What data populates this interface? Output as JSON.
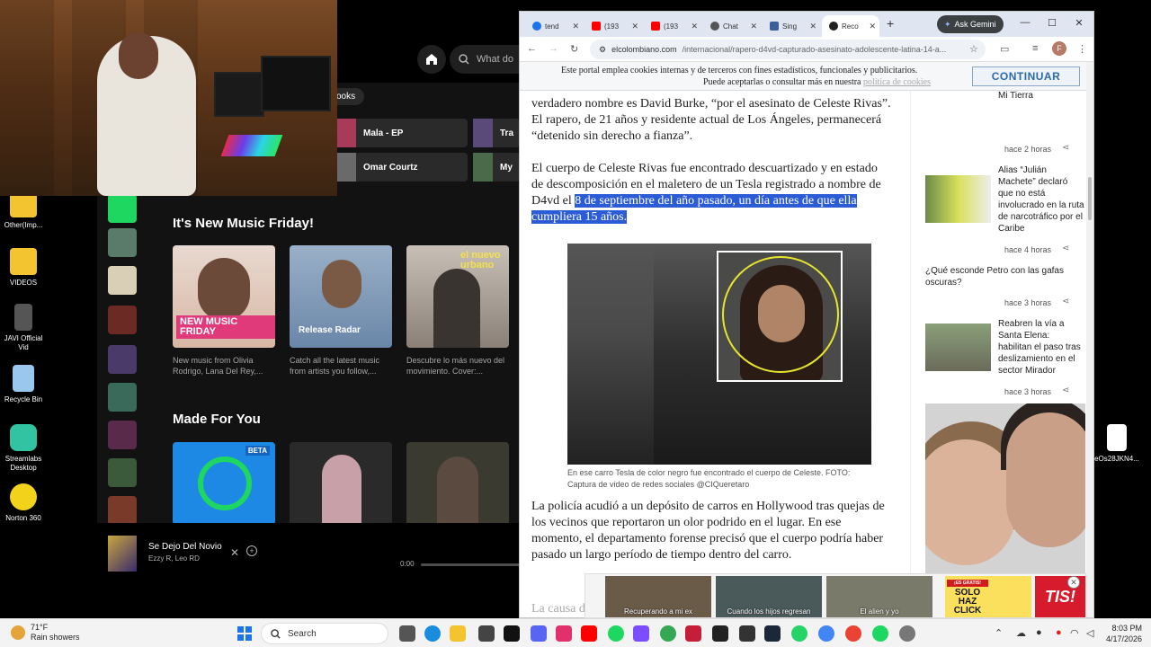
{
  "desktop": {
    "icons": [
      {
        "label": "Other(Imp...",
        "icon": "folder-icon",
        "color": "#f4c430"
      },
      {
        "label": "VIDEOS",
        "icon": "folder-icon",
        "color": "#f4c430"
      },
      {
        "label": "JAVI Official Vid",
        "icon": "video-file-icon",
        "color": "#555555"
      },
      {
        "label": "Recycle Bin",
        "icon": "recycle-bin-icon",
        "color": "#9ac7ee"
      },
      {
        "label": "Streamlabs Desktop",
        "icon": "streamlabs-icon",
        "color": "#31c3a2"
      },
      {
        "label": "Norton 360",
        "icon": "norton-icon",
        "color": "#f3d21b"
      },
      {
        "label": "eOs28JKN4...",
        "icon": "image-file-icon",
        "color": "#ffffff"
      }
    ]
  },
  "spotify": {
    "search_placeholder": "What do",
    "filter_chip": "ooks",
    "quick_picks": [
      "Mala - EP",
      "Omar Courtz",
      "Tra",
      "My"
    ],
    "section1_title": "It's New Music Friday!",
    "section1_cards": [
      {
        "cover_text": "NEW MUSIC FRIDAY",
        "desc": "New music from Olivia Rodrigo, Lana Del Rey,..."
      },
      {
        "cover_text": "Release Radar",
        "desc": "Catch all the latest music from artists you follow,..."
      },
      {
        "cover_text": "el nuevo urbano",
        "desc": "Descubre lo más nuevo del movimiento. Cover:..."
      }
    ],
    "section2_title": "Made For You",
    "section2_badge": "BETA",
    "now_playing": {
      "track": "Se Dejo Del Novio",
      "artist": "Ezzy R, Leo RD",
      "time": "0:00"
    }
  },
  "browser": {
    "tabs": [
      {
        "label": "tend",
        "fav_color": "#1a73e8"
      },
      {
        "label": "(193",
        "fav_color": "#ff0000"
      },
      {
        "label": "(193",
        "fav_color": "#ff0000"
      },
      {
        "label": "Chat",
        "fav_color": "#555555"
      },
      {
        "label": "Sing",
        "fav_color": "#3a5f9a"
      },
      {
        "label": "Reco",
        "fav_color": "#222222"
      }
    ],
    "new_tab": "+",
    "gemini_label": "Ask Gemini",
    "url_domain": "elcolombiano.com",
    "url_path": "/internacional/rapero-d4vd-capturado-asesinato-adolescente-latina-14-a...",
    "profile_initial": "F"
  },
  "cookie_banner": {
    "line1": "Este portal emplea cookies internas y de terceros con fines estadísticos, funcionales y publicitarios.",
    "line2_prefix": "Puede aceptarlas o consultar más en nuestra",
    "line2_link": "política de cookies",
    "button": "CONTINUAR"
  },
  "article": {
    "p1": "verdadero nombre es David Burke, “por el asesinato de Celeste Rivas”. El rapero, de 21 años y residente actual de Los Ángeles, permanecerá “detenido sin derecho a fianza”.",
    "p2_plain": "El cuerpo de Celeste Rivas fue encontrado descuartizado y en estado de descomposición en el maletero de un Tesla registrado a nombre de D4vd el ",
    "p2_highlight": "8 de septiembre del año pasado, un día antes de que ella cumpliera 15 años.",
    "caption": "En ese carro Tesla de color negro fue encontrado el cuerpo de Celeste. FOTO: Captura de video de redes sociales @CIQueretaro",
    "p3": "La policía acudió a un depósito de carros en Hollywood tras quejas de los vecinos que reportaron un olor podrido en el lugar. En ese momento, el departamento forense precisó que el cuerpo podría haber pasado un largo período de tiempo dentro del carro.",
    "p4": "La causa d"
  },
  "rail": {
    "item0_text": "Estadio el domingo, novedad en la Regional por Corre Mi Tierra",
    "item0_time": "hace 2 horas",
    "item1_text": "Alias “Julián Machete” declaró que no está involucrado en la ruta de narcotráfico por el Caribe",
    "item1_time": "hace 4 horas",
    "item2_text": "¿Qué esconde Petro con las gafas oscuras?",
    "item2_time": "hace 3 horas",
    "item3_text": "Reabren la vía a Santa Elena: habilitan el paso tras deslizamiento en el sector Mirador",
    "item3_time": "hace 3 horas"
  },
  "bottom_ad": {
    "clips": [
      "Recuperando a mi ex",
      "Cuando los hijos regresan",
      "El alien y yo"
    ],
    "promo_badge": "¡ES GRATIS!",
    "promo_text": "SOLO HAZ CLICK",
    "promo2_text": "TIS!"
  },
  "taskbar": {
    "temp": "71°F",
    "weather": "Rain showers",
    "search_label": "Search",
    "time": "8:03 PM",
    "date": "4/17/2026"
  },
  "colors": {
    "spotify_green": "#1ed760",
    "highlight": "#2c5bd6",
    "cookie_button_text": "#2d6aa6"
  }
}
